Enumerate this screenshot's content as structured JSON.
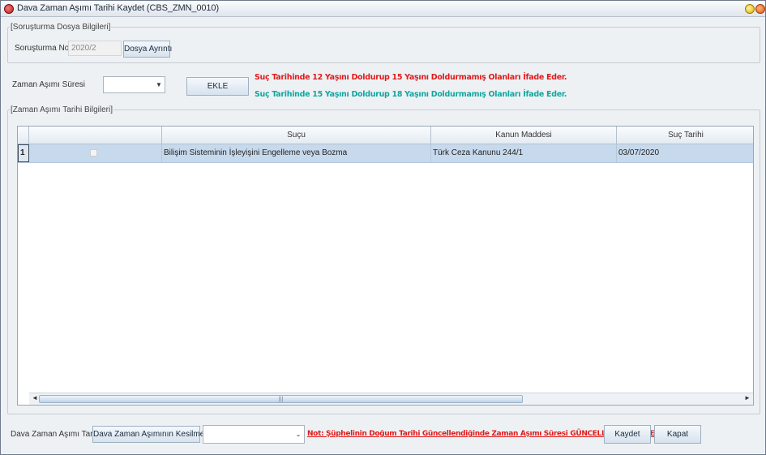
{
  "window": {
    "title": "Dava Zaman Aşımı Tarihi Kaydet (CBS_ZMN_0010)"
  },
  "investigation": {
    "legend": "[Soruşturma Dosya Bilgileri]",
    "number_label": "Soruşturma No :",
    "number_value": "2020/2",
    "details_button": "Dosya Ayrıntı"
  },
  "limitation": {
    "duration_label": "Zaman Aşımı Süresi",
    "duration_value": "",
    "add_button": "EKLE",
    "note_red": "Suç Tarihinde 12 Yaşını Doldurup 15 Yaşını Doldurmamış Olanları İfade Eder.",
    "note_teal": "Suç Tarihinde 15 Yaşını Doldurup 18 Yaşını Doldurmamış Olanları İfade Eder."
  },
  "grid": {
    "legend": "[Zaman Aşımı Tarihi Bilgileri]",
    "columns": [
      "",
      "Suçu",
      "Kanun Maddesi",
      "Suç Tarihi"
    ],
    "rows": [
      {
        "num": "1",
        "checked": false,
        "crime": "Bilişim Sisteminin İşleyişini Engelleme veya Bozma",
        "law_article": "Türk Ceza Kanunu 244/1",
        "crime_date": "03/07/2020"
      }
    ]
  },
  "footer": {
    "date_label": "Dava Zaman Aşımı Tarihi",
    "interruption_button": "Dava Zaman Aşımının Kesilmesi",
    "date_value": "",
    "warning": "Not: Şüphelinin Doğum Tarihi Güncellendiğinde Zaman Aşımı Süresi GÜNCELLENMEMEKTEDİR!",
    "save_button": "Kaydet",
    "close_button": "Kapat"
  },
  "colors": {
    "note_red": "#e01b1b",
    "note_teal": "#11a6a0",
    "row_selected": "#c7d9ec"
  }
}
